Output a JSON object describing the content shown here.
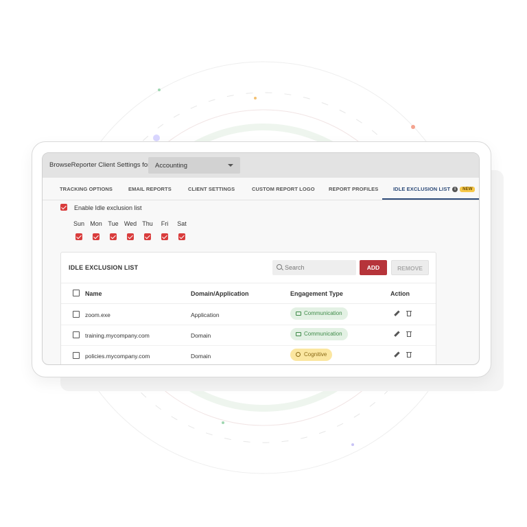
{
  "topbar": {
    "title": "BrowseReporter Client Settings for",
    "department_select": {
      "value": "Accounting"
    }
  },
  "tabs": [
    {
      "label": "TRACKING OPTIONS"
    },
    {
      "label": "EMAIL REPORTS"
    },
    {
      "label": "CLIENT SETTINGS"
    },
    {
      "label": "CUSTOM REPORT LOGO"
    },
    {
      "label": "REPORT PROFILES"
    },
    {
      "label": "IDLE EXCLUSION LIST",
      "active": true,
      "badge": "NEW"
    }
  ],
  "enable": {
    "label": "Enable Idle exclusion list",
    "checked": true
  },
  "days": [
    {
      "label": "Sun",
      "checked": true
    },
    {
      "label": "Mon",
      "checked": true
    },
    {
      "label": "Tue",
      "checked": true
    },
    {
      "label": "Wed",
      "checked": true
    },
    {
      "label": "Thu",
      "checked": true
    },
    {
      "label": "Fri",
      "checked": true
    },
    {
      "label": "Sat",
      "checked": true
    }
  ],
  "list": {
    "title": "IDLE EXCLUSION LIST",
    "search_placeholder": "Search",
    "add_label": "ADD",
    "remove_label": "REMOVE",
    "columns": [
      "Name",
      "Domain/Application",
      "Engagement Type",
      "Action"
    ],
    "rows": [
      {
        "name": "zoom.exe",
        "type": "Application",
        "engagement": "Communication"
      },
      {
        "name": "training.mycompany.com",
        "type": "Domain",
        "engagement": "Communication"
      },
      {
        "name": "policies.mycompany.com",
        "type": "Domain",
        "engagement": "Cognitive"
      }
    ]
  },
  "colors": {
    "accent_red": "#d93c3c",
    "add_button": "#b6343a",
    "active_tab": "#2c4a78",
    "communication_bg": "#e3f1e4",
    "cognitive_bg": "#fbe6a0"
  }
}
